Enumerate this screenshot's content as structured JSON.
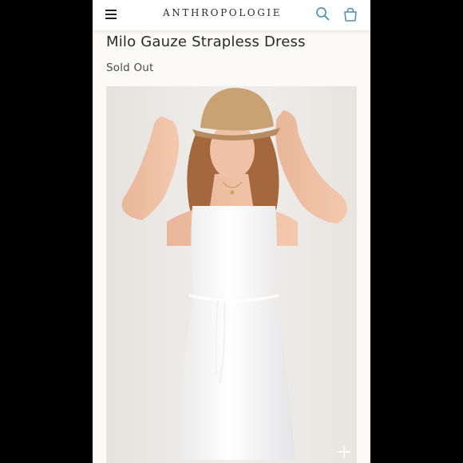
{
  "header": {
    "brand": "ANTHROPOLOGIE",
    "menu_icon": "hamburger-menu-icon",
    "search_icon": "search-icon",
    "bag_icon": "shopping-bag-icon"
  },
  "product": {
    "title": "Milo Gauze Strapless Dress",
    "availability": "Sold Out",
    "image_alt": "Model wearing a white gauze strapless dress with a drawstring waist and a straw bucket hat"
  },
  "colors": {
    "accent": "#4a8fb0",
    "page_bg": "#fbfaf7",
    "text": "#2a2a2a"
  }
}
